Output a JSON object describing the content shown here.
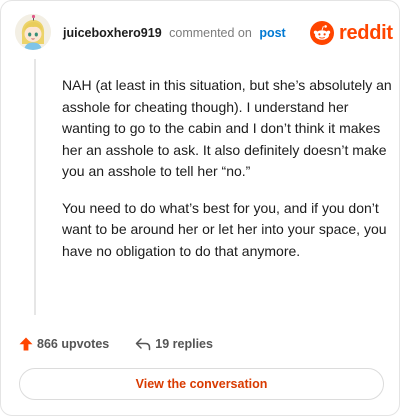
{
  "header": {
    "username": "juiceboxhero919",
    "action_text": "commented on",
    "target_text": "post",
    "brand_name": "reddit"
  },
  "comment": {
    "paragraphs": [
      "NAH (at least in this situation, but she’s absolutely an asshole for cheating though). I understand her wanting to go to the cabin and I don’t think it makes her an asshole to ask. It also definitely doesn’t make you an asshole to tell her “no.”",
      "You need to do what’s best for you, and if you don’t want to be around her or let her into your space, you have no obligation to do that anymore."
    ]
  },
  "actions": {
    "upvotes_label": "866 upvotes",
    "replies_label": "19 replies"
  },
  "footer": {
    "button_label": "View the conversation"
  },
  "icons": {
    "avatar": "avatar-icon",
    "brand": "reddit-logo-icon",
    "upvote": "upvote-arrow-icon",
    "reply": "reply-arrow-icon"
  },
  "colors": {
    "brand_orange": "#ff4500",
    "link_blue": "#0079d3",
    "button_text": "#d93a00"
  }
}
